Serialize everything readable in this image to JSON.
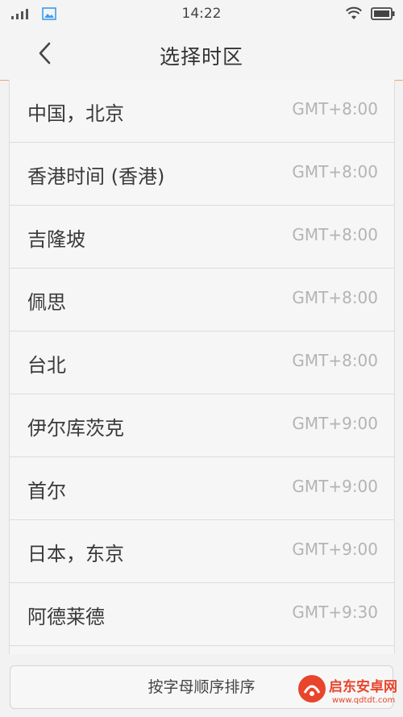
{
  "status_bar": {
    "time": "14:22"
  },
  "header": {
    "title": "选择时区",
    "back_icon": "chevron-left-icon"
  },
  "timezones": [
    {
      "name": "中国，北京",
      "offset": "GMT+8:00"
    },
    {
      "name": "香港时间 (香港)",
      "offset": "GMT+8:00"
    },
    {
      "name": "吉隆坡",
      "offset": "GMT+8:00"
    },
    {
      "name": "佩思",
      "offset": "GMT+8:00"
    },
    {
      "name": "台北",
      "offset": "GMT+8:00"
    },
    {
      "name": "伊尔库茨克",
      "offset": "GMT+9:00"
    },
    {
      "name": "首尔",
      "offset": "GMT+9:00"
    },
    {
      "name": "日本，东京",
      "offset": "GMT+9:00"
    },
    {
      "name": "阿德莱德",
      "offset": "GMT+9:30"
    }
  ],
  "footer": {
    "sort_label": "按字母顺序排序"
  },
  "watermark": {
    "title": "启东安卓网",
    "url": "www.qdtdt.com"
  },
  "colors": {
    "accent_divider": "#f0a36e",
    "status_icon_blue": "#3d9be9",
    "watermark_red": "#e8452c"
  }
}
